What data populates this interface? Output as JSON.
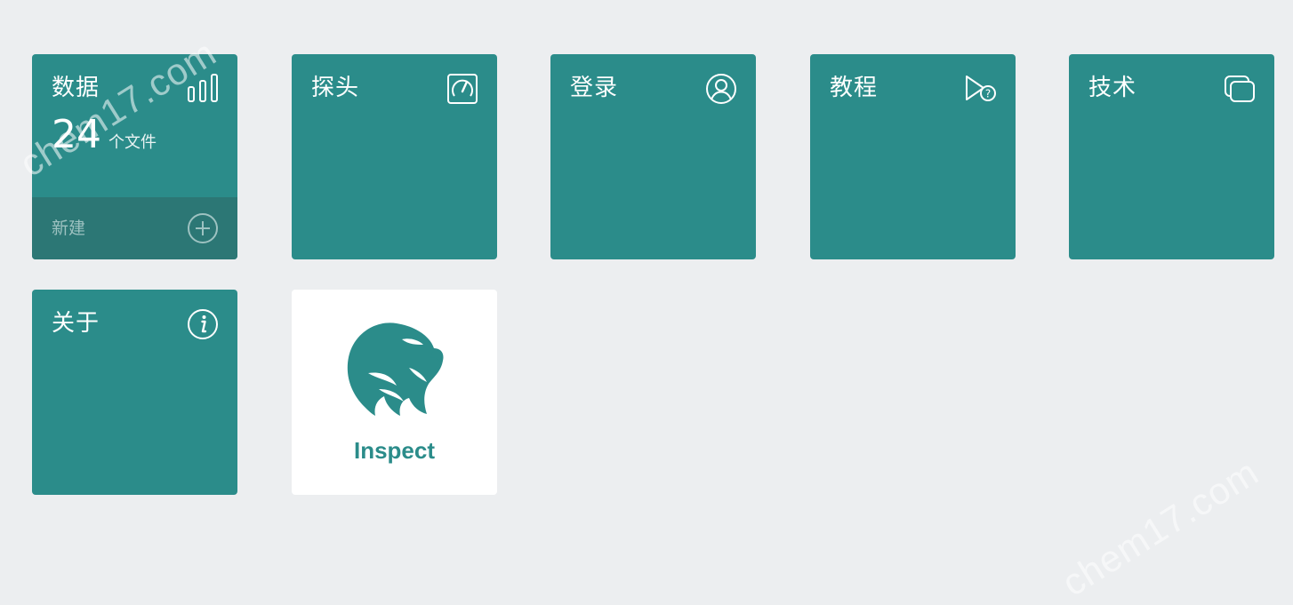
{
  "tiles": {
    "data": {
      "title": "数据",
      "count": "24",
      "count_unit": "个文件",
      "new_label": "新建",
      "icon": "bar-chart-icon"
    },
    "probe": {
      "title": "探头",
      "icon": "gauge-icon"
    },
    "login": {
      "title": "登录",
      "icon": "user-circle-icon"
    },
    "tutorial": {
      "title": "教程",
      "icon": "flag-question-icon"
    },
    "tech": {
      "title": "技术",
      "icon": "stacked-windows-icon"
    },
    "about": {
      "title": "关于",
      "icon": "info-icon"
    },
    "inspect": {
      "label": "Inspect",
      "icon": "eagle-logo"
    }
  },
  "watermark": "chem17.com",
  "colors": {
    "tile": "#2b8c8a",
    "tile_footer": "#2c7775",
    "background": "#eceef0",
    "inspect_text": "#2b8c8a"
  }
}
